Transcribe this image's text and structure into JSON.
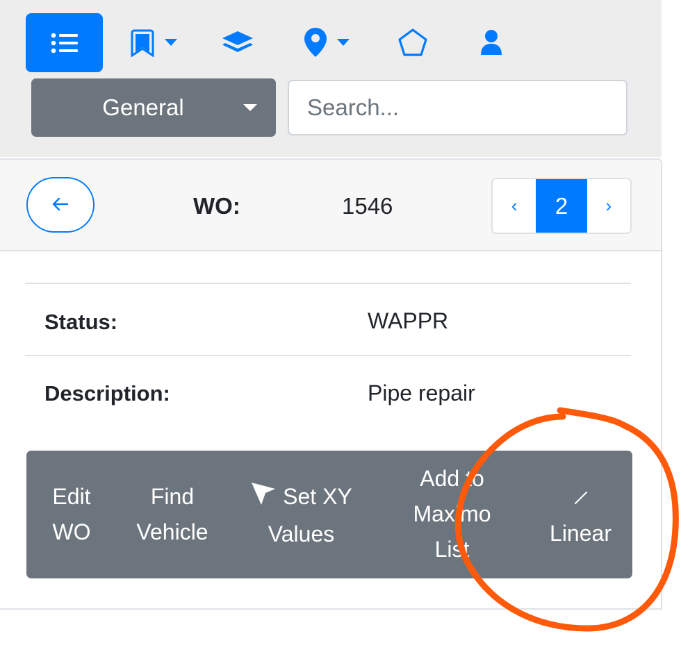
{
  "toolbar": {
    "icons": [
      "list-icon",
      "bookmark-icon",
      "layers-icon",
      "map-marker-icon",
      "polygon-icon",
      "user-icon"
    ],
    "select_value": "General",
    "search_placeholder": "Search..."
  },
  "record": {
    "label": "WO:",
    "value": "1546",
    "pager": {
      "prev": "‹",
      "current": "2",
      "next": "›"
    }
  },
  "fields": [
    {
      "label": "Status:",
      "value": "WAPPR"
    },
    {
      "label": "Description:",
      "value": "Pipe repair"
    }
  ],
  "actions": {
    "edit_wo": [
      "Edit",
      "WO"
    ],
    "find_vehicle": [
      "Find",
      "Vehicle"
    ],
    "set_xy": [
      "Set XY",
      "Values"
    ],
    "add_maximo": [
      "Add to",
      "Maximo",
      "List"
    ],
    "linear": "Linear"
  },
  "colors": {
    "primary": "#007bff",
    "secondary": "#6c757d",
    "annotation": "#ff5a0a"
  }
}
